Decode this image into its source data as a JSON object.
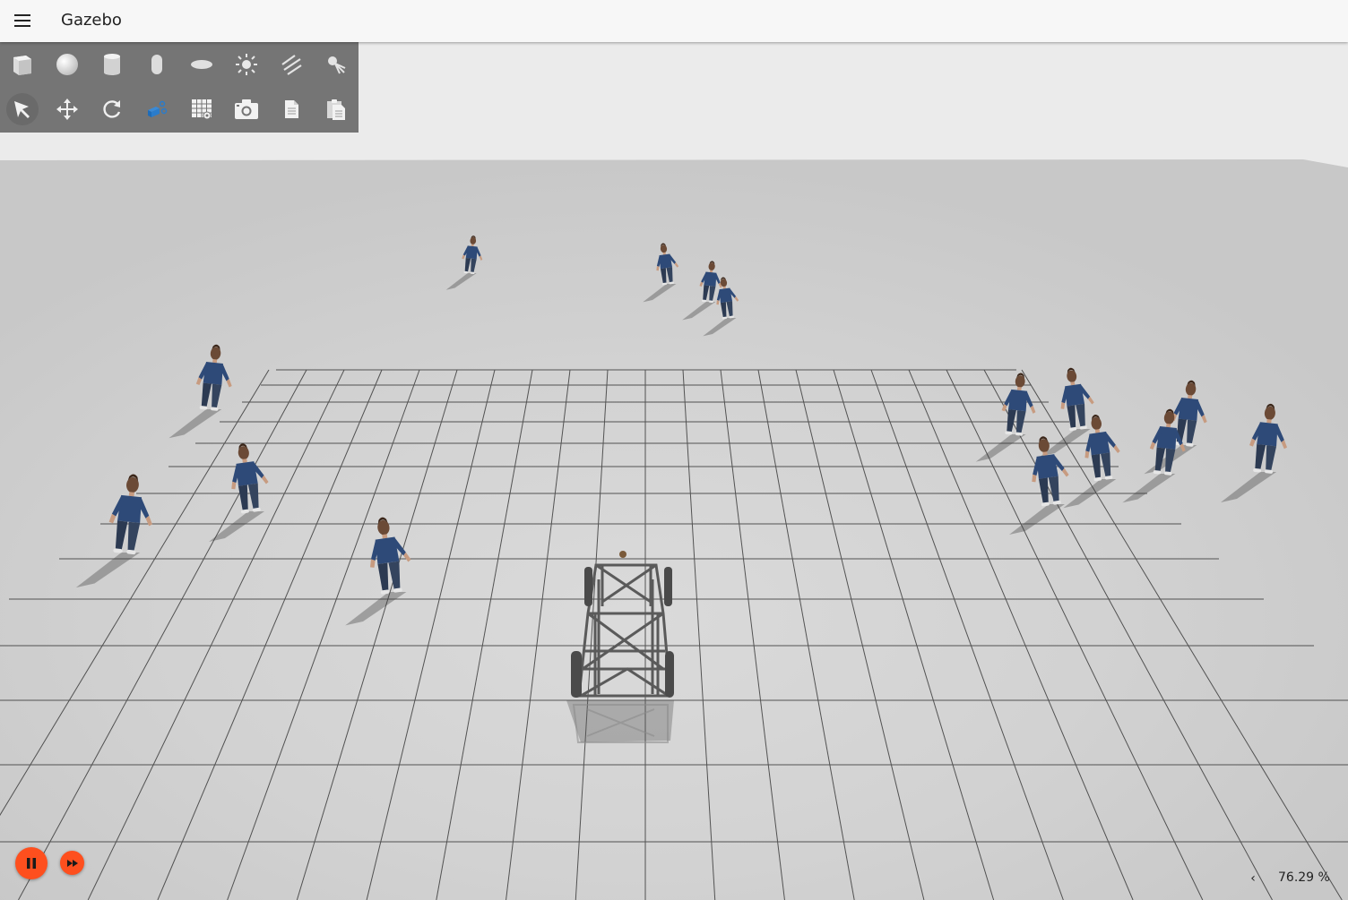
{
  "app": {
    "title": "Gazebo"
  },
  "toolbar": {
    "shapes": [
      "box-icon",
      "sphere-icon",
      "cylinder-icon",
      "capsule-icon",
      "ellipsoid-icon",
      "point-light-icon",
      "directional-light-icon",
      "spot-light-icon"
    ],
    "transform": [
      "select-icon",
      "translate-icon",
      "rotate-icon",
      "view-angle-icon",
      "grid-snap-icon",
      "screenshot-icon",
      "copy-icon",
      "paste-icon"
    ],
    "active_tool": "select-icon"
  },
  "playback": {
    "pause_icon": "pause-icon",
    "step_icon": "fast-forward-icon",
    "accent_color": "#fe4f1e"
  },
  "stats": {
    "collapse_icon": "chevron-left-icon",
    "collapse_glyph": "‹",
    "real_time_factor": "76.29 %"
  },
  "scene": {
    "background_color": "#ebebeb",
    "ground_color": "#d8d8d8",
    "grid_color": "#3c3c3c",
    "actor_count": 16,
    "vehicle": "vehicle-frame"
  }
}
